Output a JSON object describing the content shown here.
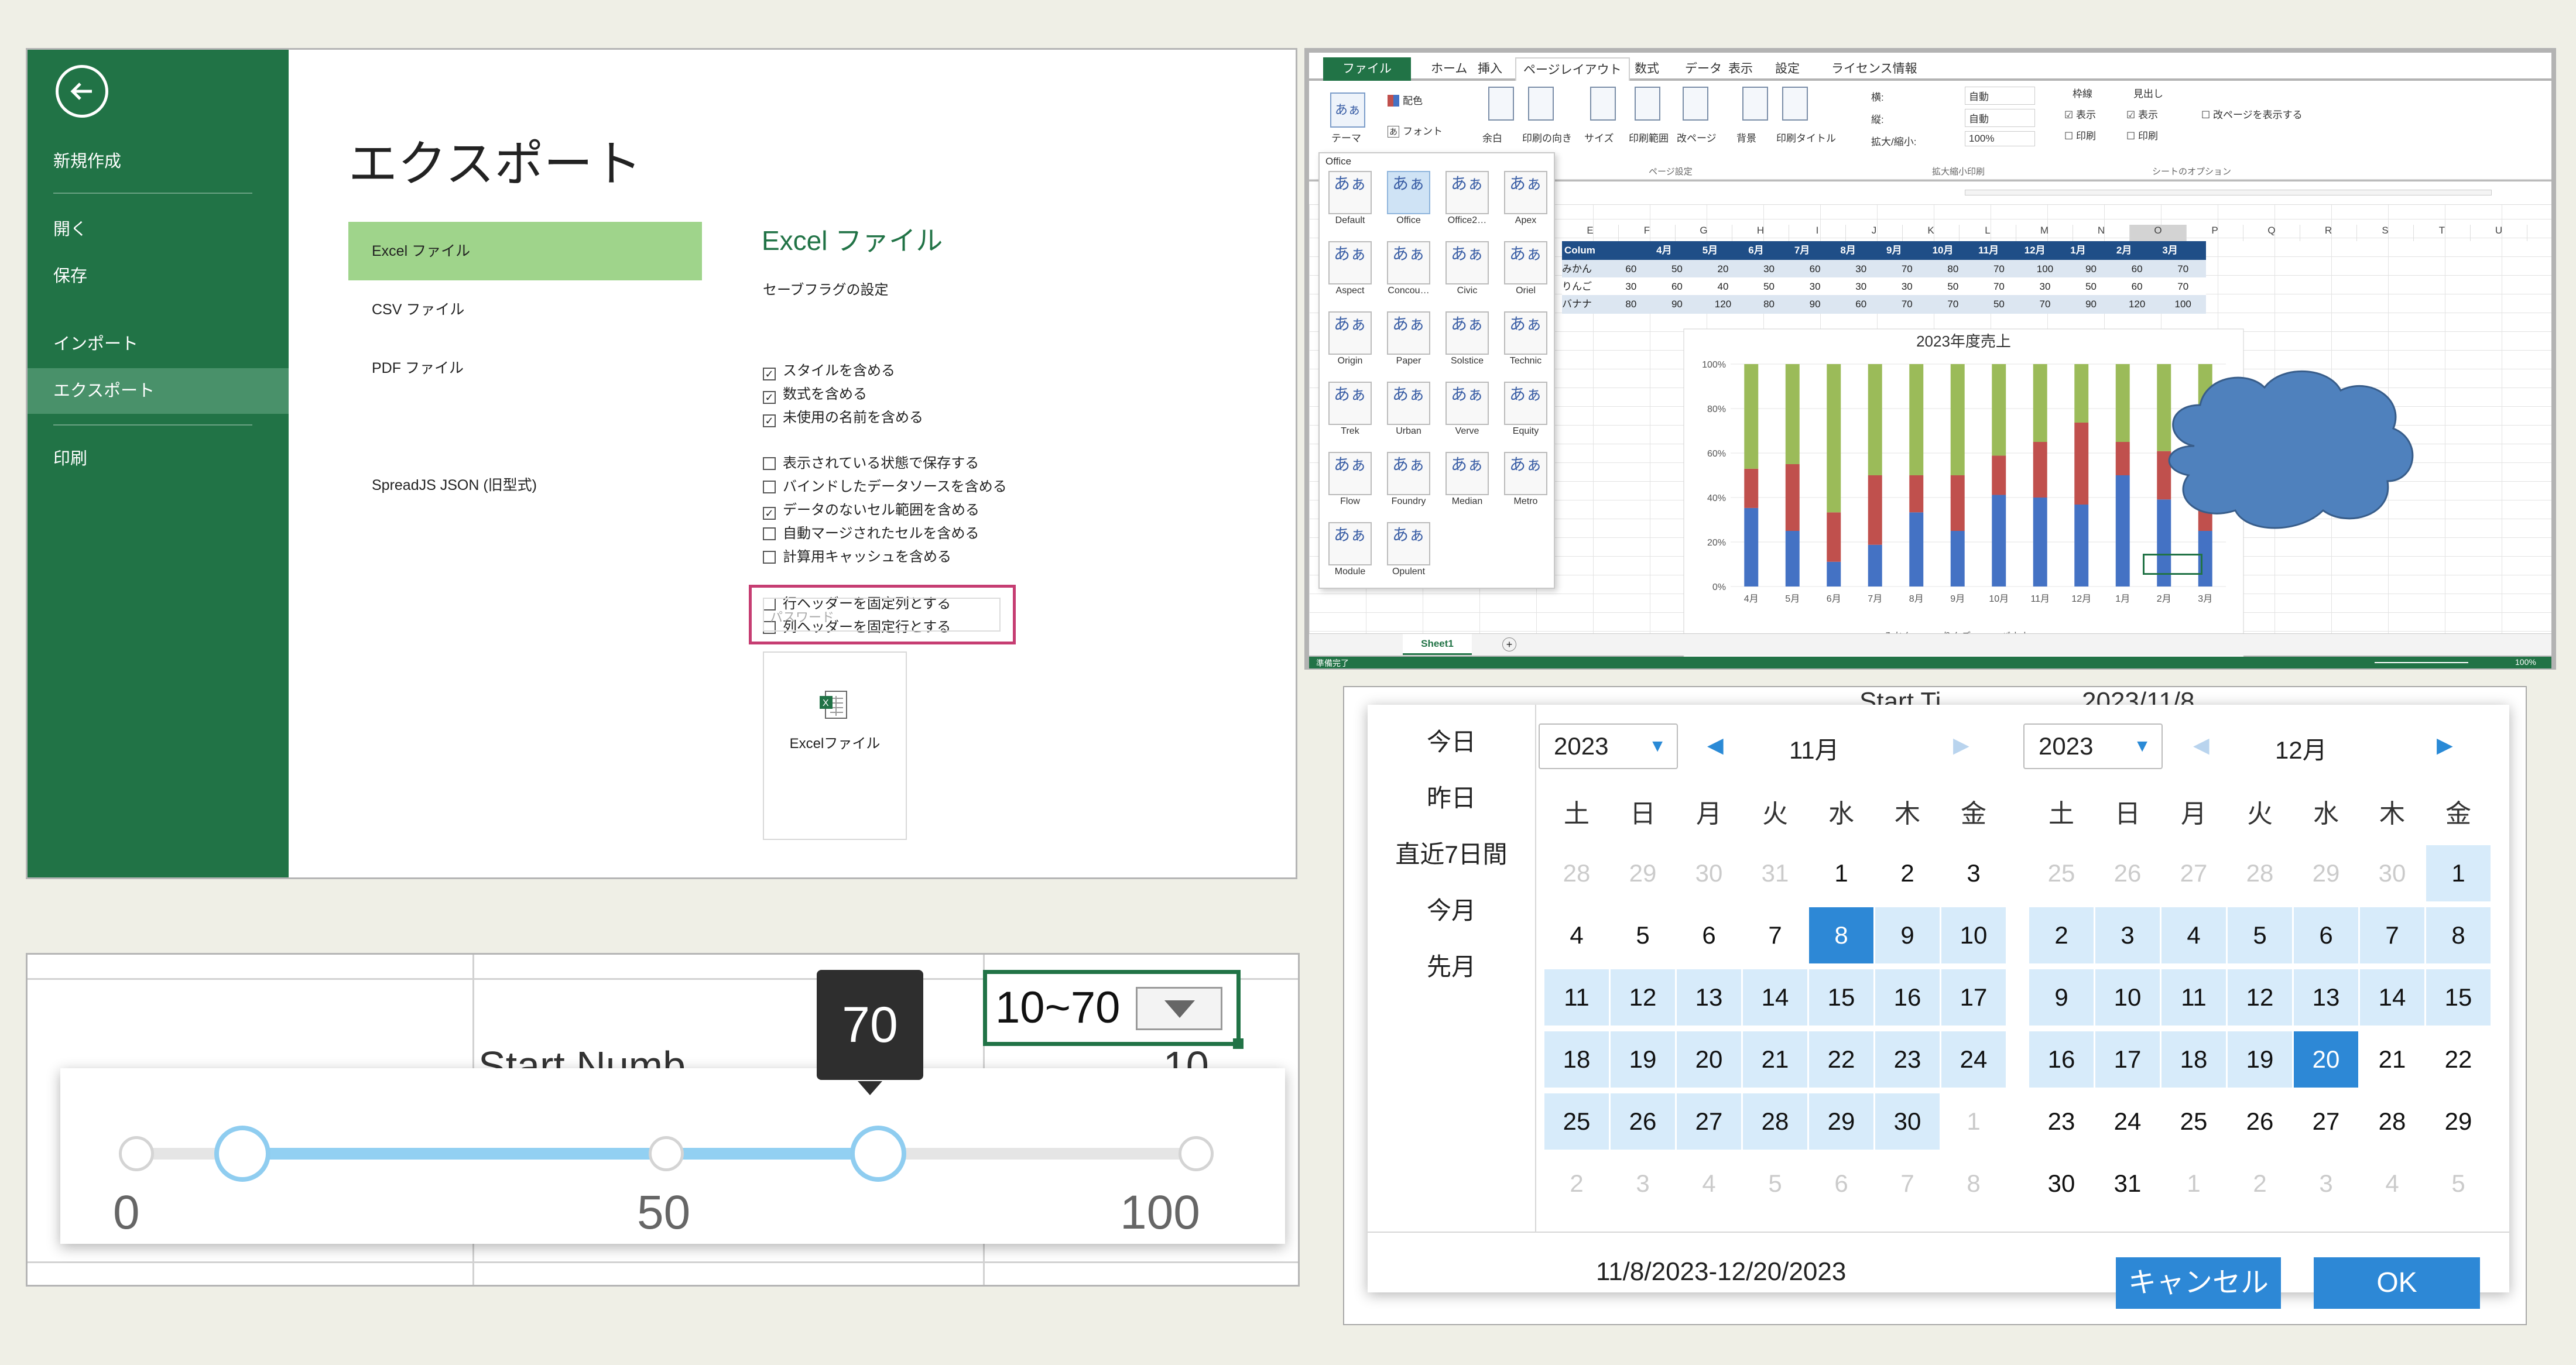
{
  "export_panel": {
    "sidebar": {
      "items": [
        "新規作成",
        "開く",
        "保存",
        "インポート",
        "エクスポート",
        "印刷"
      ],
      "selected": "エクスポート"
    },
    "title": "エクスポート",
    "file_types": [
      "Excel ファイル",
      "CSV ファイル",
      "PDF ファイル",
      "SpreadJS JSON (旧型式)"
    ],
    "selected_type": "Excel ファイル",
    "excel_title": "Excel ファイル",
    "save_flags_title": "セーブフラグの設定",
    "flags_group1": [
      {
        "label": "スタイルを含める",
        "checked": true
      },
      {
        "label": "数式を含める",
        "checked": true
      },
      {
        "label": "未使用の名前を含める",
        "checked": true
      }
    ],
    "flags_group2": [
      {
        "label": "表示されている状態で保存する",
        "checked": false
      },
      {
        "label": "バインドしたデータソースを含める",
        "checked": false
      },
      {
        "label": "データのないセル範囲を含める",
        "checked": true
      },
      {
        "label": "自動マージされたセルを含める",
        "checked": false
      },
      {
        "label": "計算用キャッシュを含める",
        "checked": false
      }
    ],
    "flags_group3": [
      {
        "label": "行ヘッダーを固定列とする",
        "checked": false
      },
      {
        "label": "列ヘッダーを固定行とする",
        "checked": false
      }
    ],
    "password_placeholder": "パスワード",
    "export_button_label": "Excelファイル"
  },
  "sheet_panel": {
    "ribbon_tabs": [
      "ファイル",
      "ホーム",
      "挿入",
      "ページレイアウト",
      "数式",
      "データ",
      "表示",
      "設定",
      "ライセンス情報"
    ],
    "active_tab": "ページレイアウト",
    "ribbon": {
      "theme": "テーマ",
      "colors": "配色",
      "fonts": "フォント",
      "margins": "余白",
      "orientation": "印刷の向き",
      "size": "サイズ",
      "print_area": "印刷範囲",
      "breaks": "改ページ",
      "background": "背景",
      "print_titles": "印刷タイトル",
      "page_setup": "ページ設定",
      "width": "横:",
      "height": "縦:",
      "auto1": "自動",
      "auto2": "自動",
      "scale": "拡大/縮小:",
      "scale_value": "100%",
      "scale_group": "拡大縮小印刷",
      "gridlines": "枠線",
      "headings": "見出し",
      "view1": "表示",
      "view2": "表示",
      "print1": "印刷",
      "print2": "印刷",
      "page_view": "改ページを表示する",
      "sheet_options": "シートのオプション"
    },
    "themes_title": "Office",
    "themes": [
      "Default",
      "Office",
      "Office2…",
      "Apex",
      "Aspect",
      "Concou…",
      "Civic",
      "Oriel",
      "Origin",
      "Paper",
      "Solstice",
      "Technic",
      "Trek",
      "Urban",
      "Verve",
      "Equity",
      "Flow",
      "Foundry",
      "Median",
      "Metro",
      "Module",
      "Opulent"
    ],
    "theme_swatch_text": "あぁ",
    "columns": [
      "E",
      "F",
      "G",
      "H",
      "I",
      "J",
      "K",
      "L",
      "M",
      "N",
      "O",
      "P",
      "Q",
      "R",
      "S",
      "T",
      "U"
    ],
    "table": {
      "header": [
        "Colum",
        "4月",
        "5月",
        "6月",
        "7月",
        "8月",
        "9月",
        "10月",
        "11月",
        "12月",
        "1月",
        "2月",
        "3月"
      ],
      "rows": [
        [
          "みかん",
          "60",
          "50",
          "20",
          "30",
          "60",
          "30",
          "70",
          "80",
          "70",
          "100",
          "90",
          "60",
          "70"
        ],
        [
          "りんご",
          "30",
          "60",
          "40",
          "50",
          "30",
          "30",
          "30",
          "50",
          "70",
          "30",
          "50",
          "60",
          "70"
        ],
        [
          "バナナ",
          "80",
          "90",
          "120",
          "80",
          "90",
          "60",
          "70",
          "70",
          "50",
          "70",
          "90",
          "120",
          "100"
        ]
      ]
    },
    "sheet_tab": "Sheet1",
    "status_left": "準備完了",
    "status_zoom": "100%"
  },
  "chart_data": {
    "type": "bar",
    "stacked": "percent",
    "title": "2023年度売上",
    "categories": [
      "4月",
      "5月",
      "6月",
      "7月",
      "8月",
      "9月",
      "10月",
      "11月",
      "12月",
      "1月",
      "2月",
      "3月"
    ],
    "series": [
      {
        "name": "みかん",
        "color": "#4472c4",
        "values": [
          60,
          50,
          20,
          30,
          60,
          30,
          70,
          80,
          70,
          100,
          90,
          60
        ]
      },
      {
        "name": "りんご",
        "color": "#c0504d",
        "values": [
          30,
          60,
          40,
          50,
          30,
          30,
          30,
          50,
          70,
          30,
          50,
          60
        ]
      },
      {
        "name": "バナナ",
        "color": "#9bbb59",
        "values": [
          80,
          90,
          120,
          80,
          90,
          60,
          70,
          70,
          50,
          70,
          90,
          120
        ]
      }
    ],
    "y_ticks": [
      "0%",
      "20%",
      "40%",
      "60%",
      "80%",
      "100%"
    ],
    "ylim": [
      0,
      100
    ],
    "legend": "bottom"
  },
  "slider_panel": {
    "cell_text": "10~70",
    "bg_text_left": "Start Numb",
    "bg_text_right": "10",
    "tooltip": "70",
    "labels": [
      "0",
      "50",
      "100"
    ],
    "range_low": 10,
    "range_high": 70,
    "min": 0,
    "max": 100
  },
  "date_panel": {
    "bg_text1": "Start Ti",
    "bg_text2": "2023/11/8",
    "shortcuts": [
      "今日",
      "昨日",
      "直近7日間",
      "今月",
      "先月"
    ],
    "left": {
      "year": "2023",
      "month": "11月"
    },
    "right": {
      "year": "2023",
      "month": "12月"
    },
    "weekdays": [
      "土",
      "日",
      "月",
      "火",
      "水",
      "木",
      "金"
    ],
    "left_days": [
      "28",
      "29",
      "30",
      "31",
      "1",
      "2",
      "3",
      "4",
      "5",
      "6",
      "7",
      "8",
      "9",
      "10",
      "11",
      "12",
      "13",
      "14",
      "15",
      "16",
      "17",
      "18",
      "19",
      "20",
      "21",
      "22",
      "23",
      "24",
      "25",
      "26",
      "27",
      "28",
      "29",
      "30",
      "1",
      "2",
      "3",
      "4",
      "5",
      "6",
      "7",
      "8"
    ],
    "right_days": [
      "25",
      "26",
      "27",
      "28",
      "29",
      "30",
      "1",
      "2",
      "3",
      "4",
      "5",
      "6",
      "7",
      "8",
      "9",
      "10",
      "11",
      "12",
      "13",
      "14",
      "15",
      "16",
      "17",
      "18",
      "19",
      "20",
      "21",
      "22",
      "23",
      "24",
      "25",
      "26",
      "27",
      "28",
      "29",
      "30",
      "31",
      "1",
      "2",
      "3",
      "4",
      "5"
    ],
    "range_text": "11/8/2023-12/20/2023",
    "cancel": "キャンセル",
    "ok": "OK"
  }
}
